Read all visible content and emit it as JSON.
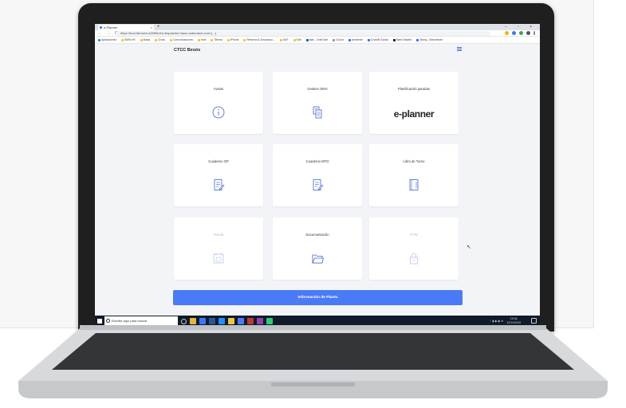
{
  "browser": {
    "tab_title": "e-Planner",
    "tab_close": "×",
    "new_tab": "+",
    "window_controls": "– ▫ ×",
    "nav_buttons": "← → C",
    "url": "https://bocrdenweb-a35f96d1b.dispatcher.hana.ondemand.com/ [...]",
    "bookmarks": [
      "Aplicaciones",
      "SMW eR",
      "Bolsa",
      "Cross",
      "Comunicaciones",
      "eset",
      "Tiberia",
      "IPhone",
      "Reforma & Decoracio...",
      "SAP",
      "Soft",
      "Mas - OneDrive",
      "iCloud",
      "Arrahede",
      "Crossfit Soriao",
      "Bank Madrid",
      "Viking - Mancheste"
    ]
  },
  "app": {
    "title": "CTCC Besós",
    "cards": [
      {
        "label": "Avisos",
        "icon": "info-icon",
        "enabled": true
      },
      {
        "label": "Gestion OM's",
        "icon": "document-grid-icon",
        "enabled": true
      },
      {
        "label": "Planificación paradas",
        "icon": "e-planner-logo",
        "logo_text": "e-planner",
        "enabled": true
      },
      {
        "label": "Cuaderno OP",
        "icon": "edit-document-icon",
        "enabled": true
      },
      {
        "label": "Cuaderno MTO",
        "icon": "edit-document-icon",
        "enabled": true
      },
      {
        "label": "Libro de Turno",
        "icon": "notebook-icon",
        "enabled": true
      },
      {
        "label": "Ronda",
        "icon": "calendar-icon",
        "enabled": false
      },
      {
        "label": "Documentación",
        "icon": "folder-icon",
        "enabled": true
      },
      {
        "label": "PTW",
        "icon": "lock-icon",
        "enabled": false
      }
    ],
    "info_button": "Información de Planta"
  },
  "taskbar": {
    "search_placeholder": "Escribe aquí para buscar",
    "time": "15:34",
    "date": "12/11/2019"
  },
  "colors": {
    "accent": "#4a7bf7",
    "icon_blue": "#3f63d6",
    "taskbar": "#0f1a2a"
  }
}
